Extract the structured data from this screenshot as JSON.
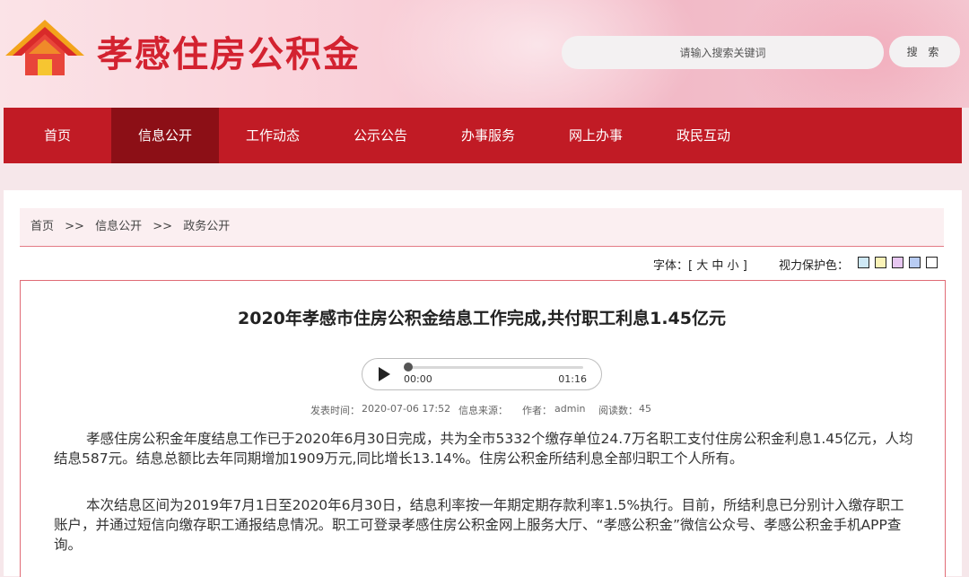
{
  "header": {
    "site_title": "孝感住房公积金",
    "search_placeholder": "请输入搜索关键词",
    "search_button": "搜 索"
  },
  "nav": {
    "items": [
      {
        "label": "首页"
      },
      {
        "label": "信息公开",
        "active": true
      },
      {
        "label": "工作动态"
      },
      {
        "label": "公示公告"
      },
      {
        "label": "办事服务"
      },
      {
        "label": "网上办事"
      },
      {
        "label": "政民互动"
      }
    ]
  },
  "breadcrumb": {
    "items": [
      "首页",
      "信息公开",
      "政务公开"
    ],
    "separator": ">>"
  },
  "tools": {
    "font_label": "字体：[",
    "font_sizes": [
      "大",
      "中",
      "小"
    ],
    "font_close": "]",
    "eye_label": "视力保护色：",
    "swatches": [
      "#cfe9f6",
      "#fbf3b8",
      "#e7c7f1",
      "#b8ccf3",
      "#ffffff"
    ]
  },
  "article": {
    "title": "2020年孝感市住房公积金结息工作完成,共付职工利息1.45亿元",
    "audio": {
      "current": "00:00",
      "duration": "01:16"
    },
    "meta": {
      "publish_time_label": "发表时间：",
      "publish_time": "2020-07-06 17:52",
      "source_label": "信息来源：",
      "source": "",
      "author_label": "作者：",
      "author": "admin",
      "reads_label": "阅读数：",
      "reads": "45"
    },
    "paragraphs": [
      "孝感住房公积金年度结息工作已于2020年6月30日完成，共为全市5332个缴存单位24.7万名职工支付住房公积金利息1.45亿元，人均结息587元。结息总额比去年同期增加1909万元,同比增长13.14%。住房公积金所结利息全部归职工个人所有。",
      "本次结息区间为2019年7月1日至2020年6月30日，结息利率按一年期定期存款利率1.5%执行。目前，所结利息已分别计入缴存职工账户，并通过短信向缴存职工通报结息情况。职工可登录孝感住房公积金网上服务大厅、“孝感公积金”微信公众号、孝感公积金手机APP查询。"
    ]
  },
  "colors": {
    "brand_red": "#c11b25",
    "nav_active": "#8c0f16",
    "title_red": "#d32230"
  }
}
